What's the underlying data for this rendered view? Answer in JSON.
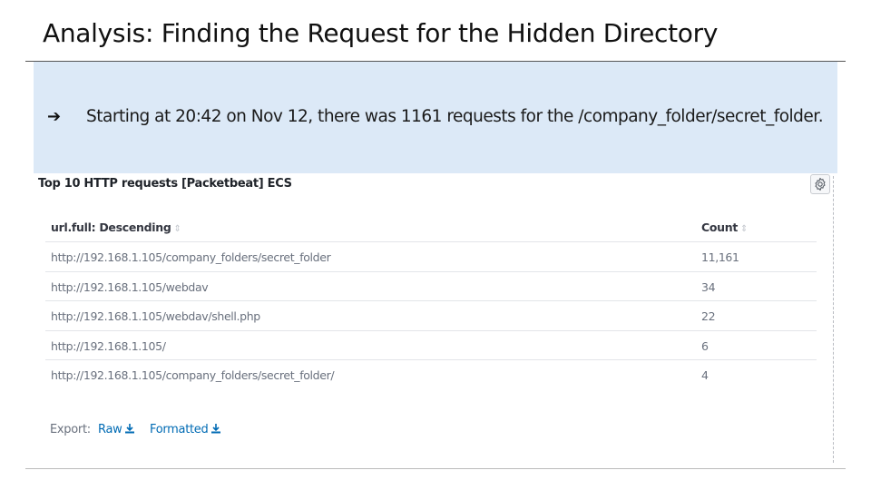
{
  "slide": {
    "title": "Analysis: Finding the Request for the Hidden Directory",
    "bullet_arrow": "➔",
    "bullet_text": "Starting at 20:42 on Nov 12, there was 1161 requests for the /company_folder/secret_folder."
  },
  "panel": {
    "title": "Top 10 HTTP requests [Packetbeat] ECS",
    "settings_icon": "gear-icon",
    "columns": {
      "url": "url.full: Descending",
      "count": "Count",
      "sort_glyph": "⇕"
    },
    "rows": [
      {
        "url": "http://192.168.1.105/company_folders/secret_folder",
        "count": "11,161"
      },
      {
        "url": "http://192.168.1.105/webdav",
        "count": "34"
      },
      {
        "url": "http://192.168.1.105/webdav/shell.php",
        "count": "22"
      },
      {
        "url": "http://192.168.1.105/",
        "count": "6"
      },
      {
        "url": "http://192.168.1.105/company_folders/secret_folder/",
        "count": "4"
      }
    ],
    "export": {
      "label": "Export:",
      "raw": "Raw",
      "formatted": "Formatted",
      "download_icon": "download-icon"
    }
  },
  "colors": {
    "callout_bg": "#dce9f7",
    "link": "#006bb4",
    "muted_text": "#69707d"
  }
}
